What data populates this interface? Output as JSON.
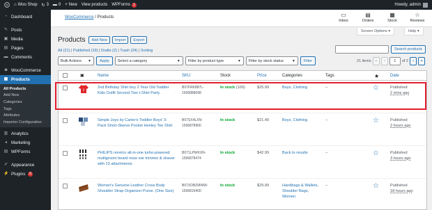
{
  "admin_bar": {
    "site_name": "Woo Shop",
    "updates_count": "3",
    "comments_count": "0",
    "new_label": "New",
    "view_products": "View products",
    "wpforms_label": "WPForms",
    "wpforms_badge": "1",
    "greeting": "Howdy, admin"
  },
  "sidebar": {
    "items": [
      {
        "label": "Dashboard",
        "icon": "dashboard-icon",
        "glyph": "◔"
      },
      {
        "label": "Posts",
        "icon": "pin-icon",
        "glyph": "✎"
      },
      {
        "label": "Media",
        "icon": "media-icon",
        "glyph": "▣"
      },
      {
        "label": "Pages",
        "icon": "page-icon",
        "glyph": "▤"
      },
      {
        "label": "Comments",
        "icon": "comment-icon",
        "glyph": "▬"
      },
      {
        "label": "WooCommerce",
        "icon": "woo-icon",
        "glyph": "◙"
      },
      {
        "label": "Products",
        "icon": "products-icon",
        "glyph": "▦"
      },
      {
        "label": "Analytics",
        "icon": "analytics-icon",
        "glyph": "▥"
      },
      {
        "label": "Marketing",
        "icon": "megaphone-icon",
        "glyph": "◂"
      },
      {
        "label": "WPForms",
        "icon": "wpforms-icon",
        "glyph": "▤"
      },
      {
        "label": "Appearance",
        "icon": "brush-icon",
        "glyph": "✐"
      },
      {
        "label": "Plugins",
        "icon": "plugin-icon",
        "glyph": "⚡",
        "badge": "6"
      }
    ],
    "submenu": [
      "All Products",
      "Add New",
      "Categories",
      "Tags",
      "Attributes",
      "Importer Configuration"
    ]
  },
  "wc_header": {
    "breadcrumb_link": "WooCommerce",
    "breadcrumb_sep": " / ",
    "breadcrumb_current": "Products",
    "inbox": "Inbox",
    "orders": "Orders",
    "stock": "Stock",
    "reviews": "Reviews"
  },
  "screen_options": "Screen Options ▾",
  "help": "Help ▾",
  "page": {
    "title": "Products",
    "add_new": "Add New",
    "import": "Import",
    "export": "Export"
  },
  "views": {
    "all": "All",
    "all_count": "(21)",
    "published": "Published",
    "published_count": "(19)",
    "drafts": "Drafts",
    "drafts_count": "(2)",
    "trash": "Trash",
    "trash_count": "(24)",
    "sorting": "Sorting",
    "sep": " | "
  },
  "search": {
    "button": "Search products"
  },
  "filters": {
    "bulk_actions": "Bulk Actions",
    "apply": "Apply",
    "category": "Select a category",
    "product_type": "Filter by product type",
    "stock_status": "Filter by stock status",
    "filter": "Filter"
  },
  "pagination": {
    "items": "21 items",
    "first": "«",
    "prev": "‹",
    "current": "1",
    "of": "of 2",
    "next": "›",
    "last": "»"
  },
  "columns": {
    "name": "Name",
    "sku": "SKU",
    "stock": "Stock",
    "price": "Price",
    "categories": "Categories",
    "tags": "Tags",
    "date": "Date"
  },
  "products": [
    {
      "name": "2nd Birthday Shirt boy 2 Year Old Toddler Kids Outfit Second Two t-Shirt Party",
      "sku": "B07FRK887L-1596888698",
      "stock_status": "In stock",
      "stock_qty": "(100)",
      "price": "$25.99",
      "categories": "Boys, Clothing",
      "tags": "–",
      "date_status": "Published",
      "date_ago": "2 mins ago",
      "thumb": "red-shirt"
    },
    {
      "name": "Simple Joys by Carter's Toddler Boys' 3-Pack Short-Sleeve Pocket Henley Tee Shirt",
      "sku": "B07SX4LXN-1596878906",
      "stock_status": "In stock",
      "stock_qty": "",
      "price": "$21.40",
      "categories": "Boys, Clothing",
      "tags": "–",
      "date_status": "Published",
      "date_ago": "3 hours ago",
      "thumb": "shirts-pack"
    },
    {
      "name": "PHILIPS norelco all-in-one turbo-powered multigroom beard nose ear trimmer & shaver with 13 attachments",
      "sku": "B071LPWKXN-1596878474",
      "stock_status": "In stock",
      "stock_qty": "",
      "price": "$42.99",
      "categories": "Back to results",
      "tags": "–",
      "date_status": "Published",
      "date_ago": "3 hours ago",
      "thumb": "trimmer-kit"
    },
    {
      "name": "Women's Genuine Leather Cross Body Shoulder Strap Organizer Purse. (One Size)",
      "sku": "B07XDBZMWW-1596819400",
      "stock_status": "In stock",
      "stock_qty": "",
      "price": "$29.99",
      "categories": "Handbags & Wallets, Shoulder Bags, Women",
      "tags": "–",
      "date_status": "Published",
      "date_ago": "18 hours ago",
      "thumb": "leather-bag"
    }
  ]
}
